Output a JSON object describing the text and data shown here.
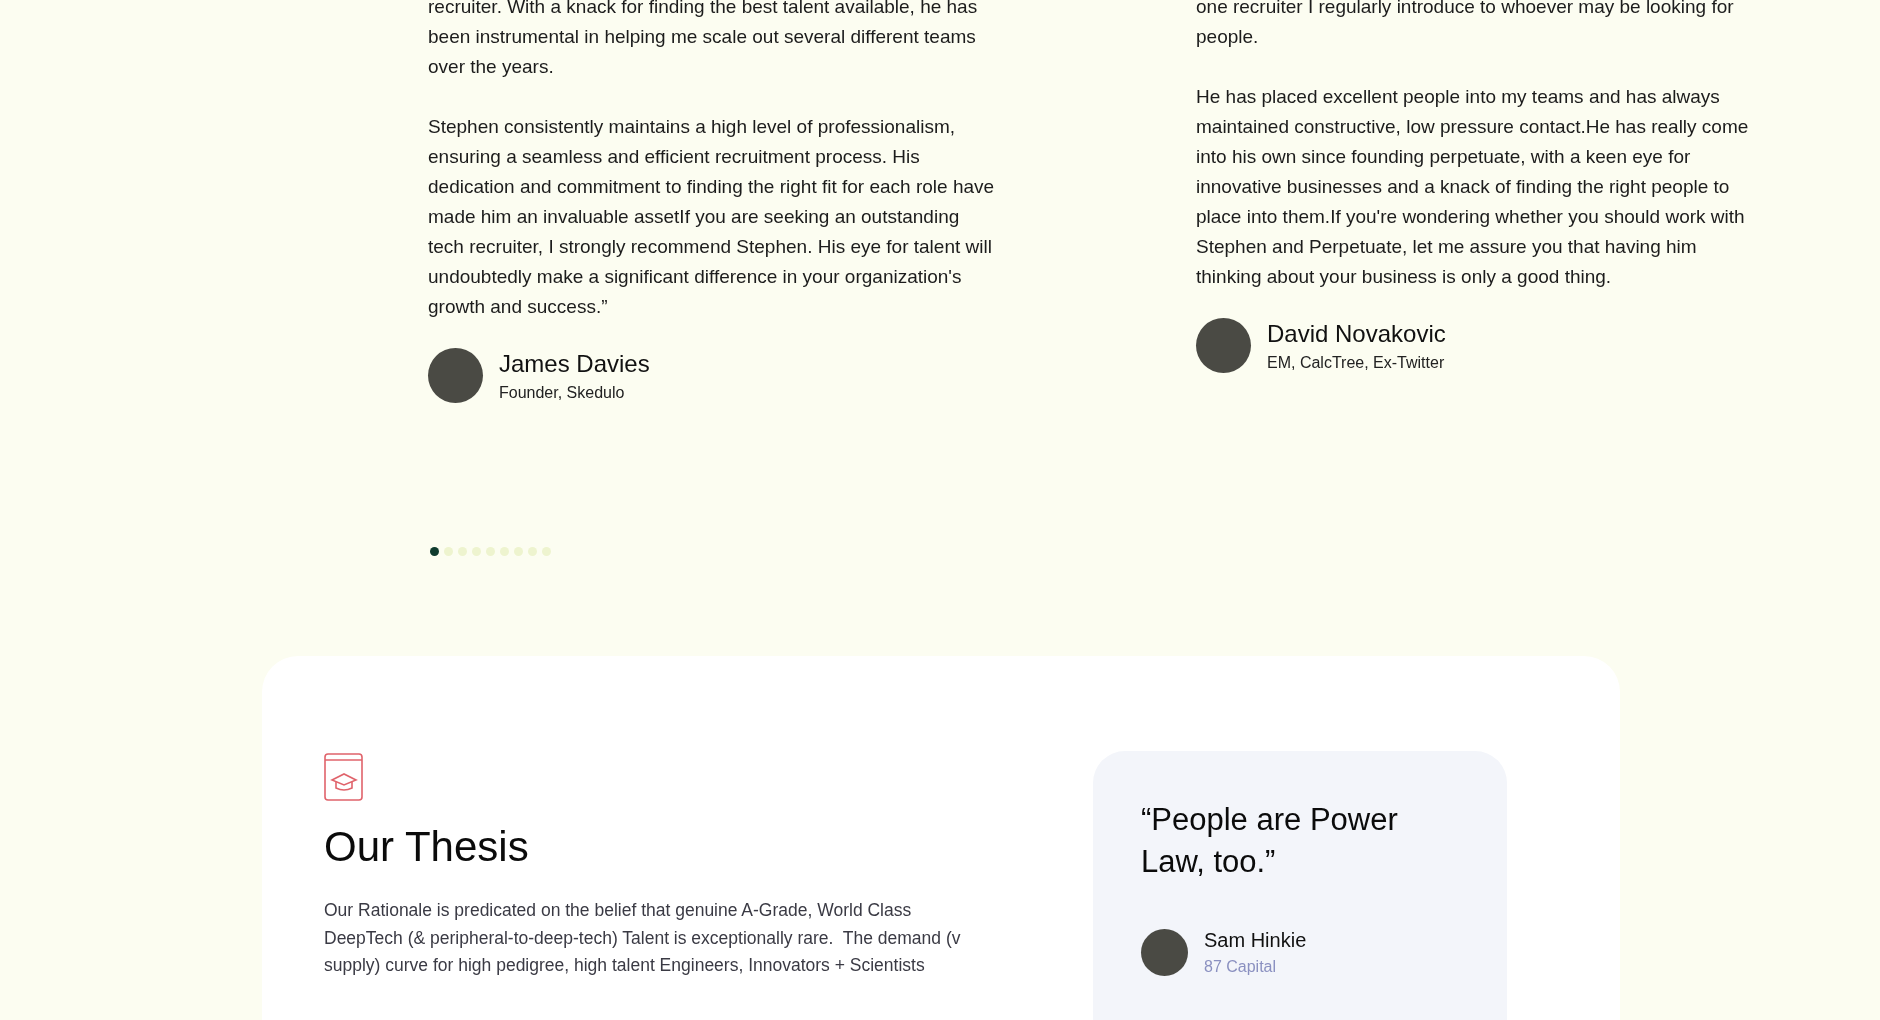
{
  "testimonials": [
    {
      "paragraphs": [
        "recruiter. With a knack for finding the best talent available, he has been instrumental in helping me scale out several different teams over the years.",
        "Stephen consistently maintains a high level of professionalism, ensuring a seamless and efficient recruitment process. His dedication and commitment to finding the right fit for each role have made him an invaluable assetIf you are seeking an outstanding tech recruiter, I strongly recommend Stephen. His eye for talent will undoubtedly make a significant difference in your organization's growth and success.”"
      ],
      "name": "James Davies",
      "role": "Founder, Skedulo"
    },
    {
      "paragraphs": [
        "one recruiter I regularly introduce to whoever may be looking for people.",
        "He has placed excellent people into my teams and has always maintained constructive, low pressure contact.He has really come into his own since founding perpetuate, with a keen eye for innovative businesses and a knack of finding the right people to place into them.If you're wondering whether you should work with Stephen and Perpetuate, let me assure you that having him thinking about your business is only a good thing."
      ],
      "name": "David Novakovic",
      "role": "EM, CalcTree, Ex-Twitter"
    }
  ],
  "carousel_dots": [
    {
      "selected": true
    },
    {
      "selected": false
    },
    {
      "selected": false
    },
    {
      "selected": false
    },
    {
      "selected": false
    },
    {
      "selected": false
    },
    {
      "selected": false
    },
    {
      "selected": false
    },
    {
      "selected": false
    }
  ],
  "thesis": {
    "title": "Our Thesis",
    "body": "Our Rationale is predicated on the belief that genuine A-Grade, World Class DeepTech (& peripheral-to-deep-tech) Talent is exceptionally rare.  The demand (v supply) curve for high pedigree, high talent Engineers, Innovators + Scientists",
    "quote": {
      "text": "“People are Power Law, too.”",
      "name": "Sam Hinkie",
      "company": "87 Capital"
    }
  }
}
